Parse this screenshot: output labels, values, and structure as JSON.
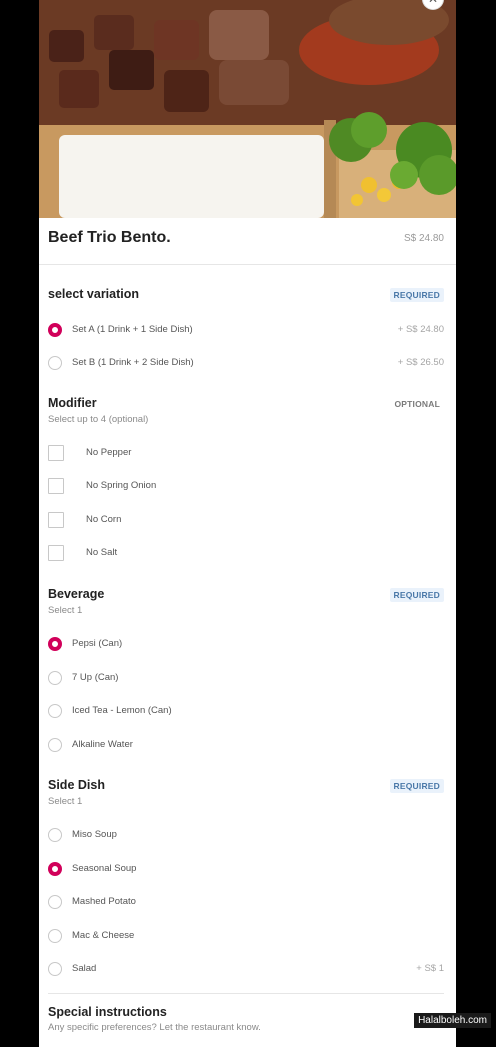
{
  "item": {
    "title": "Beef Trio Bento.",
    "price": "S$ 24.80"
  },
  "variation": {
    "heading": "select variation",
    "badge": "REQUIRED",
    "options": [
      {
        "label": "Set A (1 Drink + 1 Side Dish)",
        "price": "+ S$ 24.80",
        "selected": true
      },
      {
        "label": "Set B (1 Drink + 2 Side Dish)",
        "price": "+ S$ 26.50",
        "selected": false
      }
    ]
  },
  "modifier": {
    "heading": "Modifier",
    "subtitle": "Select up to 4 (optional)",
    "badge": "OPTIONAL",
    "options": [
      {
        "label": "No Pepper",
        "checked": false
      },
      {
        "label": "No Spring Onion",
        "checked": false
      },
      {
        "label": "No Corn",
        "checked": false
      },
      {
        "label": "No Salt",
        "checked": false
      }
    ]
  },
  "beverage": {
    "heading": "Beverage",
    "subtitle": "Select 1",
    "badge": "REQUIRED",
    "options": [
      {
        "label": "Pepsi (Can)",
        "selected": true
      },
      {
        "label": "7 Up (Can)",
        "selected": false
      },
      {
        "label": "Iced Tea - Lemon (Can)",
        "selected": false
      },
      {
        "label": "Alkaline Water",
        "selected": false
      }
    ]
  },
  "side_dish": {
    "heading": "Side Dish",
    "subtitle": "Select 1",
    "badge": "REQUIRED",
    "options": [
      {
        "label": "Miso Soup",
        "selected": false,
        "price": ""
      },
      {
        "label": "Seasonal Soup",
        "selected": true,
        "price": ""
      },
      {
        "label": "Mashed Potato",
        "selected": false,
        "price": ""
      },
      {
        "label": "Mac & Cheese",
        "selected": false,
        "price": ""
      },
      {
        "label": "Salad",
        "selected": false,
        "price": "+ S$ 1"
      }
    ]
  },
  "special": {
    "heading": "Special instructions",
    "subtitle": "Any specific preferences? Let the restaurant know."
  },
  "watermark": "Halalboleh.com",
  "colors": {
    "accent": "#d1005a",
    "required_badge_bg": "#eaf2fb",
    "required_badge_text": "#4a78a8"
  },
  "icons": {
    "close": "close-icon"
  }
}
